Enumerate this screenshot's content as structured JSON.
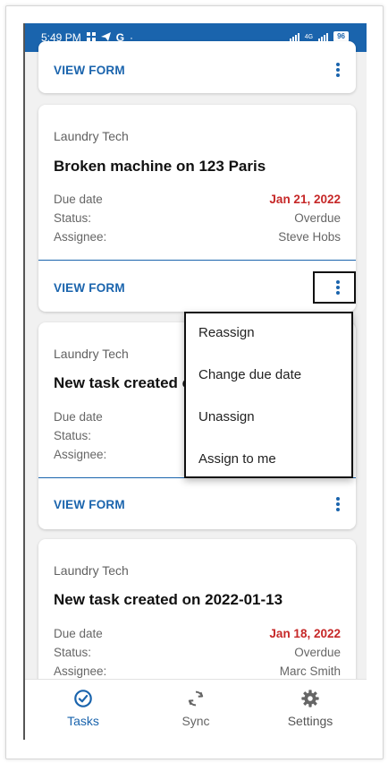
{
  "status_bar": {
    "time": "5:49 PM",
    "notification_icons": [
      "grid-icon",
      "telegram-icon",
      "google-icon",
      "dot-icon"
    ],
    "network_label": "4G",
    "battery": "96"
  },
  "cards": [
    {
      "action_label": "VIEW FORM"
    },
    {
      "org": "Laundry Tech",
      "title": "Broken machine on 123 Paris",
      "due_label": "Due date",
      "due_value": "Jan 21, 2022",
      "status_label": "Status:",
      "status_value": "Overdue",
      "assignee_label": "Assignee:",
      "assignee_value": "Steve Hobs",
      "action_label": "VIEW FORM"
    },
    {
      "org": "Laundry Tech",
      "title": "New task created o",
      "due_label": "Due date",
      "status_label": "Status:",
      "assignee_label": "Assignee:",
      "action_label": "VIEW FORM"
    },
    {
      "org": "Laundry Tech",
      "title": "New task created on 2022-01-13",
      "due_label": "Due date",
      "due_value": "Jan 18, 2022",
      "status_label": "Status:",
      "status_value": "Overdue",
      "assignee_label": "Assignee:",
      "assignee_value": "Marc Smith"
    }
  ],
  "context_menu": {
    "items": [
      "Reassign",
      "Change due date",
      "Unassign",
      "Assign to me"
    ]
  },
  "bottom_nav": {
    "tasks": "Tasks",
    "sync": "Sync",
    "settings": "Settings",
    "active": "Tasks"
  },
  "colors": {
    "primary": "#1a64ad",
    "overdue": "#c62828",
    "inactive": "#666666"
  }
}
